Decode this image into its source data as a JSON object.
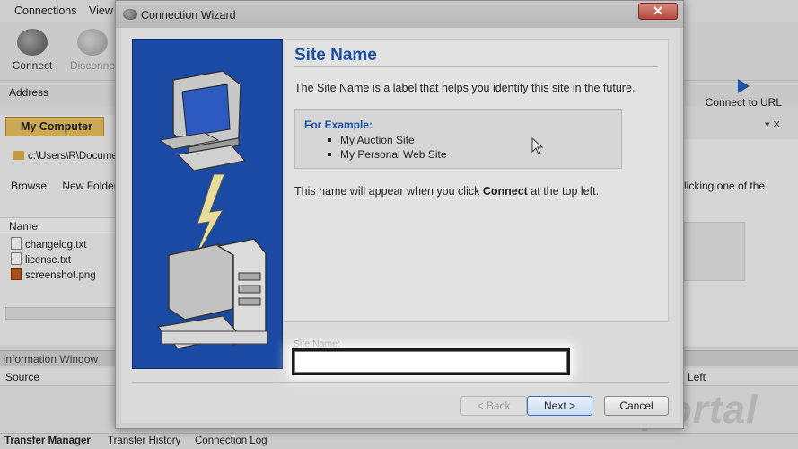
{
  "background_app": {
    "menu": [
      "Connections",
      "View"
    ],
    "toolbar": {
      "connect_label": "Connect",
      "disconnect_label": "Disconnect",
      "address_label": "Address",
      "connect_url_label": "Connect to URL"
    },
    "left_pane": {
      "tab_label": "My Computer",
      "path": "c:\\Users\\R\\Documents",
      "browse_label": "Browse",
      "new_folder_label": "New Folder",
      "name_header": "Name",
      "files": [
        "changelog.txt",
        "license.txt",
        "screenshot.png"
      ]
    },
    "right_pane": {
      "hint_fragment": "licking one of the"
    },
    "info_window_label": "Information Window",
    "columns": {
      "source": "Source",
      "left": "Left"
    },
    "bottom_tabs": [
      "Transfer Manager",
      "Transfer History",
      "Connection Log"
    ],
    "watermark": "portal"
  },
  "dialog": {
    "title": "Connection Wizard",
    "close_label": "✕",
    "heading": "Site Name",
    "description": "The Site Name is a label that helps you identify this site in the future.",
    "example": {
      "title": "For Example:",
      "items": [
        "My Auction Site",
        "My Personal Web Site"
      ]
    },
    "note_prefix": "This name will appear when you click ",
    "note_bold": "Connect",
    "note_suffix": " at the top left.",
    "site_name_label": "Site Name:",
    "site_name_value": "",
    "buttons": {
      "back": "< Back",
      "next": "Next >",
      "cancel": "Cancel"
    }
  },
  "colors": {
    "accent_blue": "#1a4fa0",
    "illustration_blue": "#1b4aa4",
    "close_red": "#b4483c"
  }
}
